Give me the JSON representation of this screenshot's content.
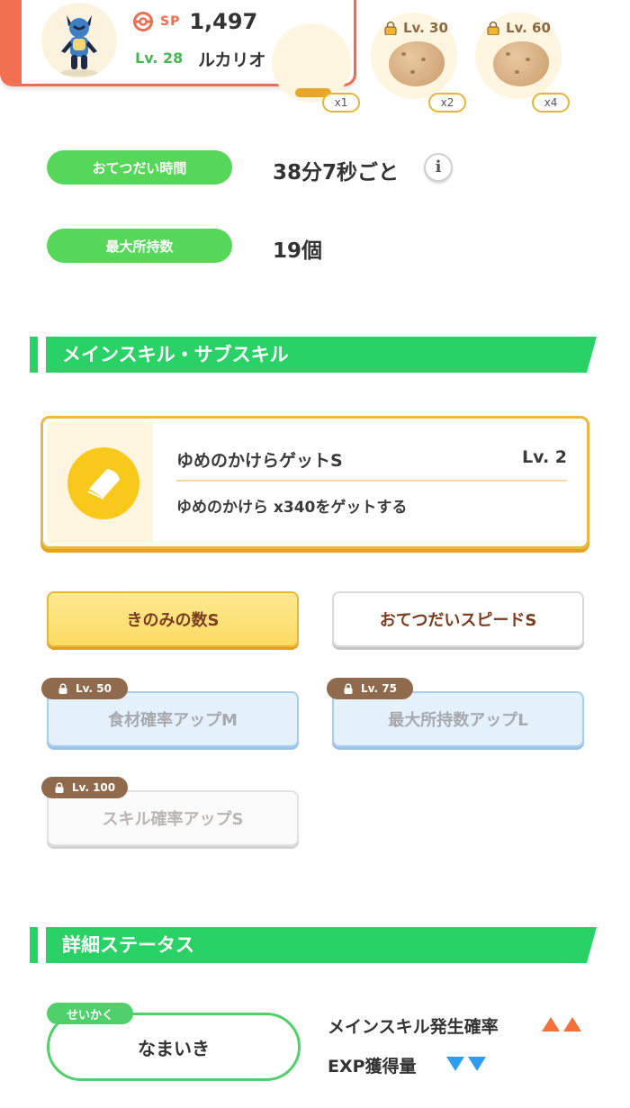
{
  "pokemon": {
    "sp_label": "SP",
    "sp_value": "1,497",
    "level": "Lv. 28",
    "name": "ルカリオ"
  },
  "ingredients": [
    {
      "count": "x1",
      "locked": false
    },
    {
      "lock_level": "Lv. 30",
      "count": "x2",
      "locked": true,
      "icon": "potato-icon"
    },
    {
      "lock_level": "Lv. 60",
      "count": "x4",
      "locked": true,
      "icon": "potato-icon"
    }
  ],
  "stats": {
    "help_time_label": "おてつだい時間",
    "help_time_value": "38分7秒ごと",
    "info_glyph": "i",
    "max_carry_label": "最大所持数",
    "max_carry_value": "19個"
  },
  "skills_section": {
    "title": "メインスキル・サブスキル",
    "main_skill": {
      "name": "ゆめのかけらゲットS",
      "level": "Lv. 2",
      "description": "ゆめのかけら x340をゲットする",
      "icon": "dream-shard-icon"
    },
    "sub_skills": [
      {
        "label": "きのみの数S",
        "state": "active"
      },
      {
        "label": "おてつだいスピードS",
        "state": "unlocked"
      },
      {
        "label": "食材確率アップM",
        "state": "locked",
        "lock_level": "Lv. 50"
      },
      {
        "label": "最大所持数アップL",
        "state": "locked",
        "lock_level": "Lv. 75"
      },
      {
        "label": "スキル確率アップS",
        "state": "locked",
        "lock_level": "Lv. 100"
      }
    ]
  },
  "details_section": {
    "title": "詳細ステータス",
    "nature_tag": "せいかく",
    "nature": "なまいき",
    "effects": [
      {
        "label": "メインスキル発生確率",
        "direction": "up",
        "color": "#f26f3a"
      },
      {
        "label": "EXP獲得量",
        "direction": "down",
        "color": "#2f9cf0"
      }
    ]
  },
  "colors": {
    "accent_green": "#2ad166",
    "header_red": "#f26f4f",
    "skill_gold": "#f0b73a"
  }
}
